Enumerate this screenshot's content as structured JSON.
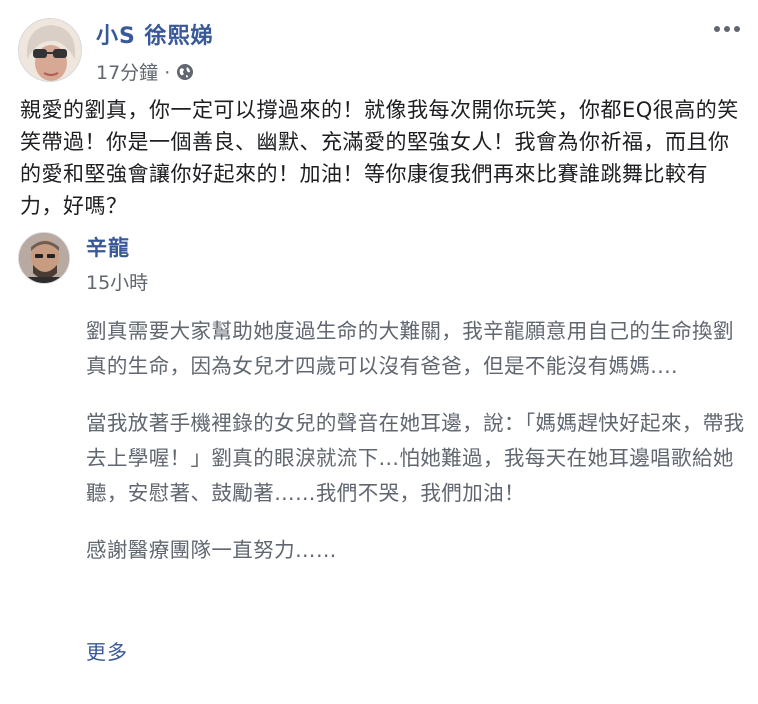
{
  "post": {
    "author": "小S 徐熙娣",
    "time": "17分鐘 ·",
    "privacy_icon": "globe-icon",
    "more_icon": "more-horizontal-icon",
    "text": "親愛的劉真，你一定可以撐過來的！就像我每次開你玩笑，你都EQ很高的笑笑帶過！你是一個善良、幽默、充滿愛的堅強女人！我會為你祈福，而且你的愛和堅強會讓你好起來的！加油！等你康復我們再來比賽誰跳舞比較有力，好嗎？"
  },
  "shared": {
    "author": "辛龍",
    "time": "15小時",
    "paragraphs": [
      "劉真需要大家幫助她度過生命的大難關，我辛龍願意用自己的生命換劉真的生命，因為女兒才四歲可以沒有爸爸，但是不能沒有媽媽....",
      "當我放著手機裡錄的女兒的聲音在她耳邊，說：「媽媽趕快好起來，帶我去上學喔！」劉真的眼淚就流下...怕她難過，我每天在她耳邊唱歌給她聽，安慰著、鼓勵著……我們不哭，我們加油！",
      "感謝醫療團隊一直努力……"
    ],
    "see_more": "更多"
  },
  "colors": {
    "link": "#385898",
    "meta": "#606770",
    "text": "#1c1e21"
  }
}
